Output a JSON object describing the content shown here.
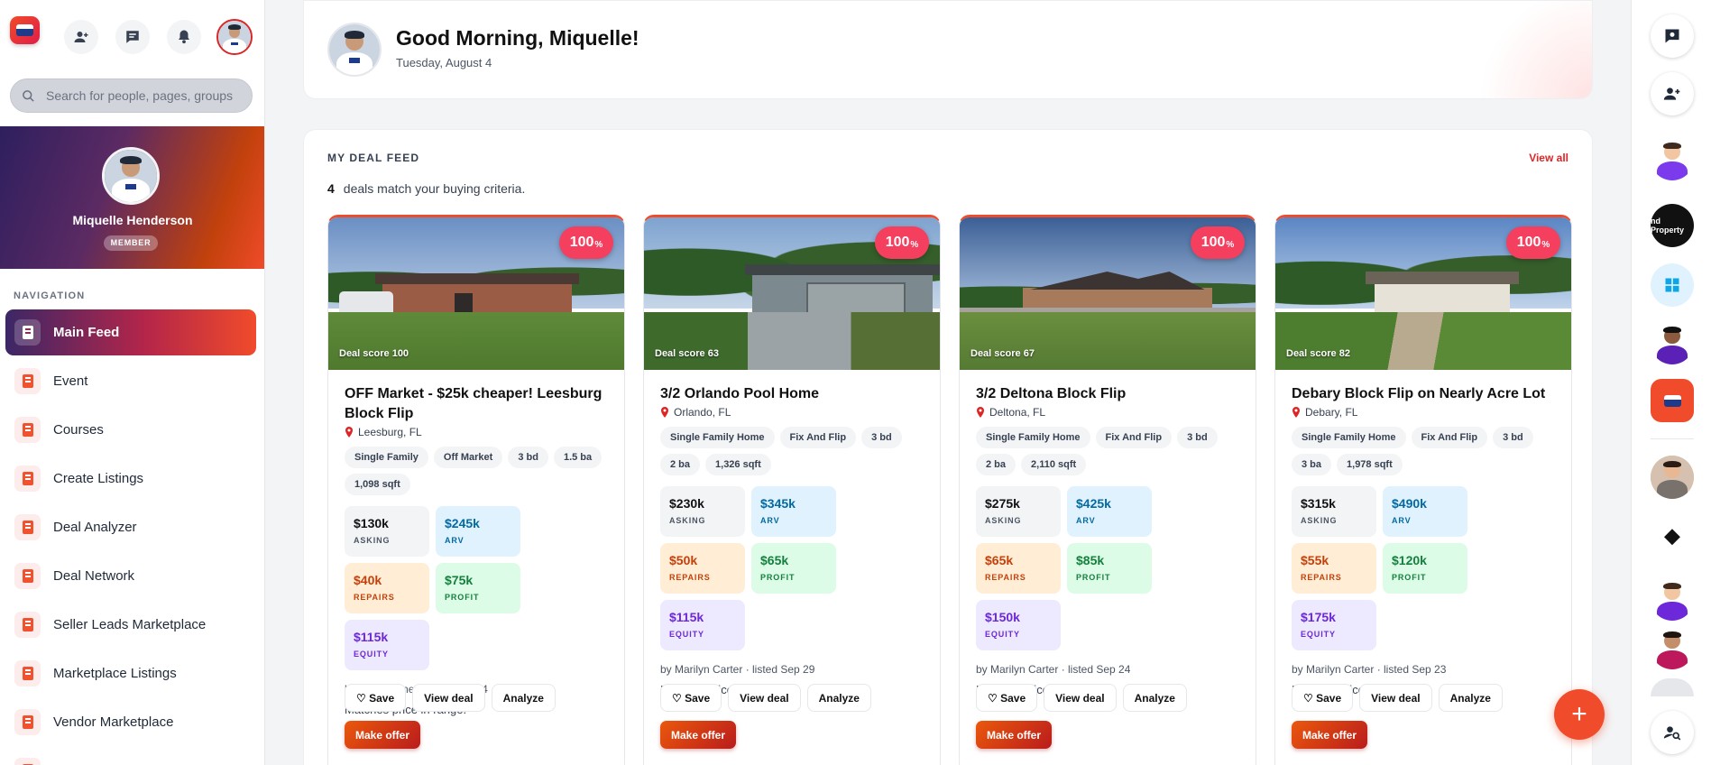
{
  "search": {
    "placeholder": "Search for people, pages, groups"
  },
  "profile": {
    "name": "Miquelle Henderson",
    "role": "MEMBER"
  },
  "nav": {
    "heading": "NAVIGATION",
    "items": [
      {
        "label": "Main Feed",
        "icon": "feed-icon"
      },
      {
        "label": "Event",
        "icon": "event-icon"
      },
      {
        "label": "Courses",
        "icon": "courses-icon"
      },
      {
        "label": "Create Listings",
        "icon": "create-listings-icon"
      },
      {
        "label": "Deal Analyzer",
        "icon": "deal-analyzer-icon"
      },
      {
        "label": "Deal Network",
        "icon": "deal-network-icon"
      },
      {
        "label": "Seller Leads Marketplace",
        "icon": "seller-leads-icon"
      },
      {
        "label": "Marketplace Listings",
        "icon": "marketplace-icon"
      },
      {
        "label": "Vendor Marketplace",
        "icon": "vendor-icon"
      }
    ]
  },
  "greeting": {
    "title": "Good Morning, Miquelle!",
    "date": "Tuesday, August 4"
  },
  "feed": {
    "label": "MY DEAL FEED",
    "view_all": "View all",
    "match_count": "4",
    "match_text": "deals match your buying criteria.",
    "cards": [
      {
        "pct": "100",
        "pct_unit": "%",
        "score_label": "Deal score 100",
        "title": "OFF Market - $25k cheaper! Leesburg Block Flip",
        "location": "Leesburg, FL",
        "tags": [
          "Single Family",
          "Off Market",
          "3 bd",
          "1.5 ba",
          "1,098 sqft"
        ],
        "asking": "$130k",
        "arv": "$245k",
        "repairs": "$40k",
        "profit": "$75k",
        "equity": "$115k",
        "meta": "by Aftab Ahmed · listed May 4",
        "reason": "Matches price in range."
      },
      {
        "pct": "100",
        "pct_unit": "%",
        "score_label": "Deal score 63",
        "title": "3/2 Orlando Pool Home",
        "location": "Orlando, FL",
        "tags": [
          "Single Family Home",
          "Fix And Flip",
          "3 bd",
          "2 ba",
          "1,326 sqft"
        ],
        "asking": "$230k",
        "arv": "$345k",
        "repairs": "$50k",
        "profit": "$65k",
        "equity": "$115k",
        "meta": "by Marilyn Carter · listed Sep 29",
        "reason": "Matches price in range."
      },
      {
        "pct": "100",
        "pct_unit": "%",
        "score_label": "Deal score 67",
        "title": "3/2 Deltona Block Flip",
        "location": "Deltona, FL",
        "tags": [
          "Single Family Home",
          "Fix And Flip",
          "3 bd",
          "2 ba",
          "2,110 sqft"
        ],
        "asking": "$275k",
        "arv": "$425k",
        "repairs": "$65k",
        "profit": "$85k",
        "equity": "$150k",
        "meta": "by Marilyn Carter · listed Sep 24",
        "reason": "Matches price in range."
      },
      {
        "pct": "100",
        "pct_unit": "%",
        "score_label": "Deal score 82",
        "title": "Debary Block Flip on Nearly Acre Lot",
        "location": "Debary, FL",
        "tags": [
          "Single Family Home",
          "Fix And Flip",
          "3 bd",
          "3 ba",
          "1,978 sqft"
        ],
        "asking": "$315k",
        "arv": "$490k",
        "repairs": "$55k",
        "profit": "$120k",
        "equity": "$175k",
        "meta": "by Marilyn Carter · listed Sep 23",
        "reason": "Matches price in range."
      }
    ]
  },
  "stat_labels": {
    "asking": "ASKING",
    "arv": "ARV",
    "repairs": "REPAIRS",
    "profit": "PROFIT",
    "equity": "EQUITY"
  },
  "actions": {
    "save": "♡ Save",
    "view": "View deal",
    "analyze": "Analyze",
    "offer": "Make offer"
  },
  "rail": {
    "page_logo_text": "nd Property"
  },
  "fab": {
    "label": "+"
  },
  "colors": {
    "brand": "#f04b2a",
    "accent_red": "#dc2626",
    "score_pill": "#f43f5e"
  }
}
